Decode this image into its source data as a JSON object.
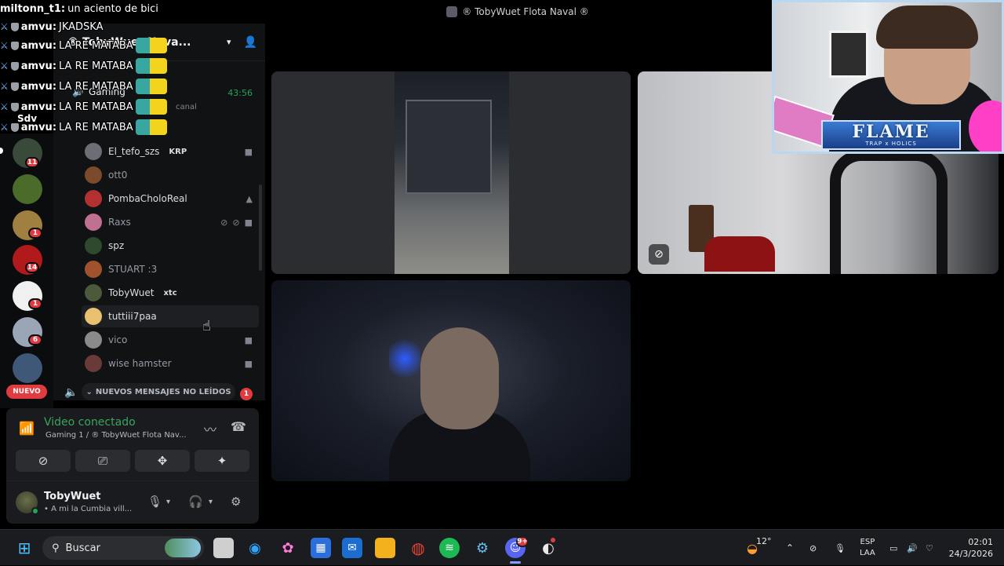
{
  "window": {
    "title": "® TobyWuet Flota Naval ®"
  },
  "chat_overlay": [
    {
      "user": "miltonn_t1:",
      "message": "un aciento de bici",
      "emote": false,
      "badges": false
    },
    {
      "user": "amvu:",
      "message": "JKADSKA",
      "emote": false,
      "badges": true
    },
    {
      "user": "amvu:",
      "message": "LA RE MATABA",
      "emote": true,
      "badges": true
    },
    {
      "user": "amvu:",
      "message": "LA RE MATABA",
      "emote": true,
      "badges": true
    },
    {
      "user": "amvu:",
      "message": "LA RE MATABA",
      "emote": true,
      "badges": true
    },
    {
      "user": "amvu:",
      "message": "LA RE MATABA",
      "emote": true,
      "badges": true
    },
    {
      "user": "amvu:",
      "message": "LA RE MATABA",
      "emote": true,
      "badges": true
    }
  ],
  "chat_extra": "Sdv",
  "server": {
    "name": "® TobyWuet",
    "name_tail": "Nava...",
    "channel": "Gaming",
    "channel_sub": "canal",
    "timer": "43:56"
  },
  "servers": [
    {
      "badge": "11",
      "color": "#3a4a3a"
    },
    {
      "badge": "",
      "color": "#4b6b2a"
    },
    {
      "badge": "1",
      "color": "#a08040"
    },
    {
      "badge": "14",
      "color": "#b01a1a"
    },
    {
      "badge": "1",
      "color": "#f0f0f0"
    },
    {
      "badge": "6",
      "color": "#9aa5b5"
    },
    {
      "badge": "",
      "color": "#405878"
    }
  ],
  "nuevo_label": "NUEVO",
  "members": [
    {
      "name": "El_tefo_szs",
      "tag": "KRP",
      "muted": false,
      "icons": "video",
      "avatar": "#6b6f75"
    },
    {
      "name": "ott0",
      "tag": "",
      "muted": true,
      "icons": "",
      "avatar": "#7a4a2a"
    },
    {
      "name": "PombaCholoReal",
      "tag": "",
      "muted": false,
      "icons": "game",
      "avatar": "#b33030"
    },
    {
      "name": "Raxs",
      "tag": "",
      "muted": true,
      "icons": "mute-deaf-video",
      "avatar": "#c07090"
    },
    {
      "name": "spz",
      "tag": "",
      "muted": false,
      "icons": "",
      "avatar": "#2e4a2e"
    },
    {
      "name": "STUART :3",
      "tag": "",
      "muted": true,
      "icons": "",
      "avatar": "#a0522d"
    },
    {
      "name": "TobyWuet",
      "tag": "xtc",
      "muted": false,
      "icons": "",
      "avatar": "#4a5a3a"
    },
    {
      "name": "tuttiii7paa",
      "tag": "",
      "muted": false,
      "icons": "",
      "avatar": "#e8c070"
    },
    {
      "name": "vico",
      "tag": "",
      "muted": true,
      "icons": "video",
      "avatar": "#8a8a8a"
    },
    {
      "name": "wise hamster",
      "tag": "",
      "muted": true,
      "icons": "video",
      "avatar": "#6a3a3a"
    }
  ],
  "unread_bar": {
    "label": "NUEVOS MENSAJES NO LEÍDOS",
    "count": "1"
  },
  "voice": {
    "status": "Video conectado",
    "location": "Gaming 1 / ® TobyWuet Flota Nav..."
  },
  "user": {
    "name": "TobyWuet",
    "status": "• A mi la Cumbia vill..."
  },
  "webcam": {
    "banner_title": "FLAME",
    "banner_sub": "TRAP x HOLICS"
  },
  "taskbar": {
    "search_placeholder": "Buscar",
    "weather": "12°",
    "lang_top": "ESP",
    "lang_bottom": "LAA",
    "time": "02:01",
    "date": "24/3/2026",
    "discord_badge": "9+"
  },
  "colors": {
    "online": "#23a559",
    "badge_red": "#e03b3f",
    "voice_green": "#3ba55d"
  }
}
